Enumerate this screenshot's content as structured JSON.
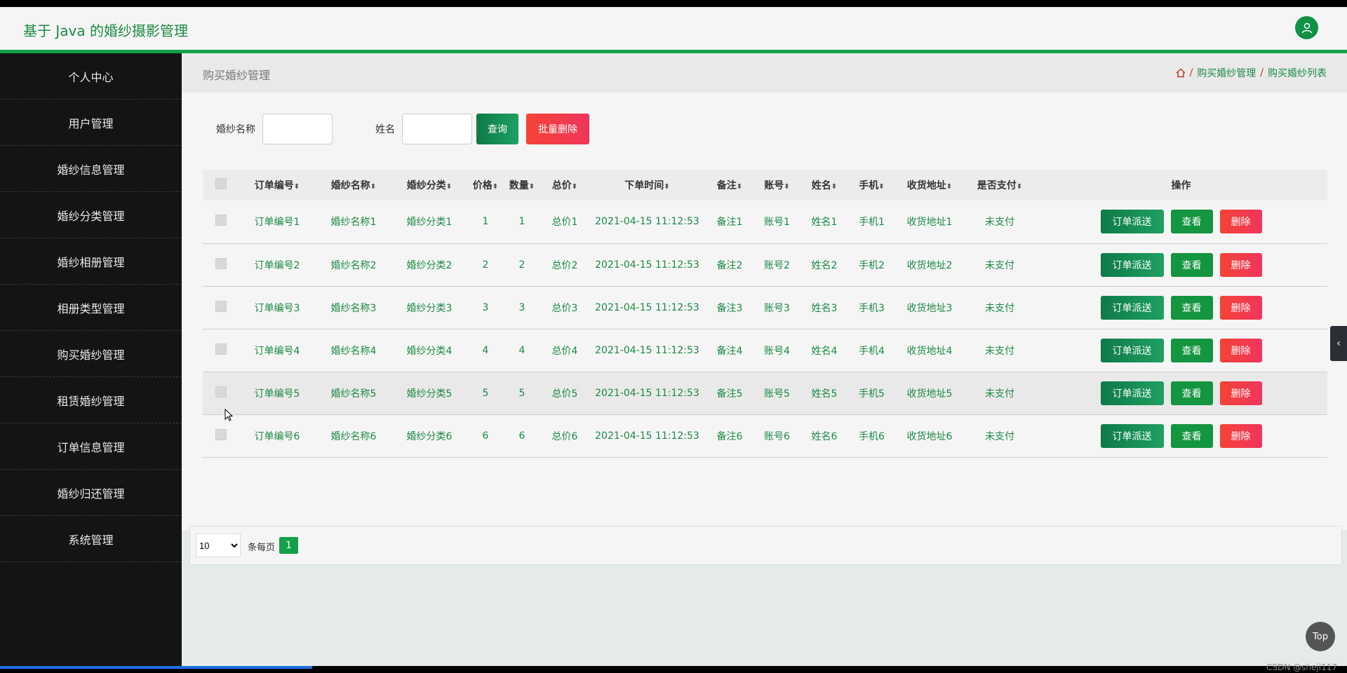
{
  "app": {
    "title": "基于 Java 的婚纱摄影管理",
    "user_icon": "user-icon"
  },
  "sidebar": {
    "items": [
      {
        "label": "个人中心"
      },
      {
        "label": "用户管理"
      },
      {
        "label": "婚纱信息管理"
      },
      {
        "label": "婚纱分类管理"
      },
      {
        "label": "婚纱相册管理"
      },
      {
        "label": "相册类型管理"
      },
      {
        "label": "购买婚纱管理"
      },
      {
        "label": "租赁婚纱管理"
      },
      {
        "label": "订单信息管理"
      },
      {
        "label": "婚纱归还管理"
      },
      {
        "label": "系统管理"
      }
    ]
  },
  "page": {
    "title": "购买婚纱管理",
    "breadcrumb": [
      "购买婚纱管理",
      "购买婚纱列表"
    ],
    "breadcrumb_sep": "/"
  },
  "search": {
    "name_label": "婚纱名称",
    "name_value": "",
    "person_label": "姓名",
    "person_value": "",
    "query_label": "查询",
    "batch_delete_label": "批量删除"
  },
  "table": {
    "sort_glyph": "⬍",
    "columns": [
      "订单编号",
      "婚纱名称",
      "婚纱分类",
      "价格",
      "数量",
      "总价",
      "下单时间",
      "备注",
      "账号",
      "姓名",
      "手机",
      "收货地址",
      "是否支付"
    ],
    "ops_header": "操作",
    "rows": [
      [
        "订单编号1",
        "婚纱名称1",
        "婚纱分类1",
        "1",
        "1",
        "总价1",
        "2021-04-15 11:12:53",
        "备注1",
        "账号1",
        "姓名1",
        "手机1",
        "收货地址1",
        "未支付"
      ],
      [
        "订单编号2",
        "婚纱名称2",
        "婚纱分类2",
        "2",
        "2",
        "总价2",
        "2021-04-15 11:12:53",
        "备注2",
        "账号2",
        "姓名2",
        "手机2",
        "收货地址2",
        "未支付"
      ],
      [
        "订单编号3",
        "婚纱名称3",
        "婚纱分类3",
        "3",
        "3",
        "总价3",
        "2021-04-15 11:12:53",
        "备注3",
        "账号3",
        "姓名3",
        "手机3",
        "收货地址3",
        "未支付"
      ],
      [
        "订单编号4",
        "婚纱名称4",
        "婚纱分类4",
        "4",
        "4",
        "总价4",
        "2021-04-15 11:12:53",
        "备注4",
        "账号4",
        "姓名4",
        "手机4",
        "收货地址4",
        "未支付"
      ],
      [
        "订单编号5",
        "婚纱名称5",
        "婚纱分类5",
        "5",
        "5",
        "总价5",
        "2021-04-15 11:12:53",
        "备注5",
        "账号5",
        "姓名5",
        "手机5",
        "收货地址5",
        "未支付"
      ],
      [
        "订单编号6",
        "婚纱名称6",
        "婚纱分类6",
        "6",
        "6",
        "总价6",
        "2021-04-15 11:12:53",
        "备注6",
        "账号6",
        "姓名6",
        "手机6",
        "收货地址6",
        "未支付"
      ]
    ],
    "ops": {
      "dispatch": "订单派送",
      "view": "查看",
      "delete": "删除"
    }
  },
  "pager": {
    "page_size": "10",
    "per_page_label": "条每页",
    "current_page": "1"
  },
  "misc": {
    "top_label": "Top",
    "watermark": "CSDN @sheji117"
  },
  "colors": {
    "accent": "#14a04a",
    "danger": "#f44336"
  }
}
